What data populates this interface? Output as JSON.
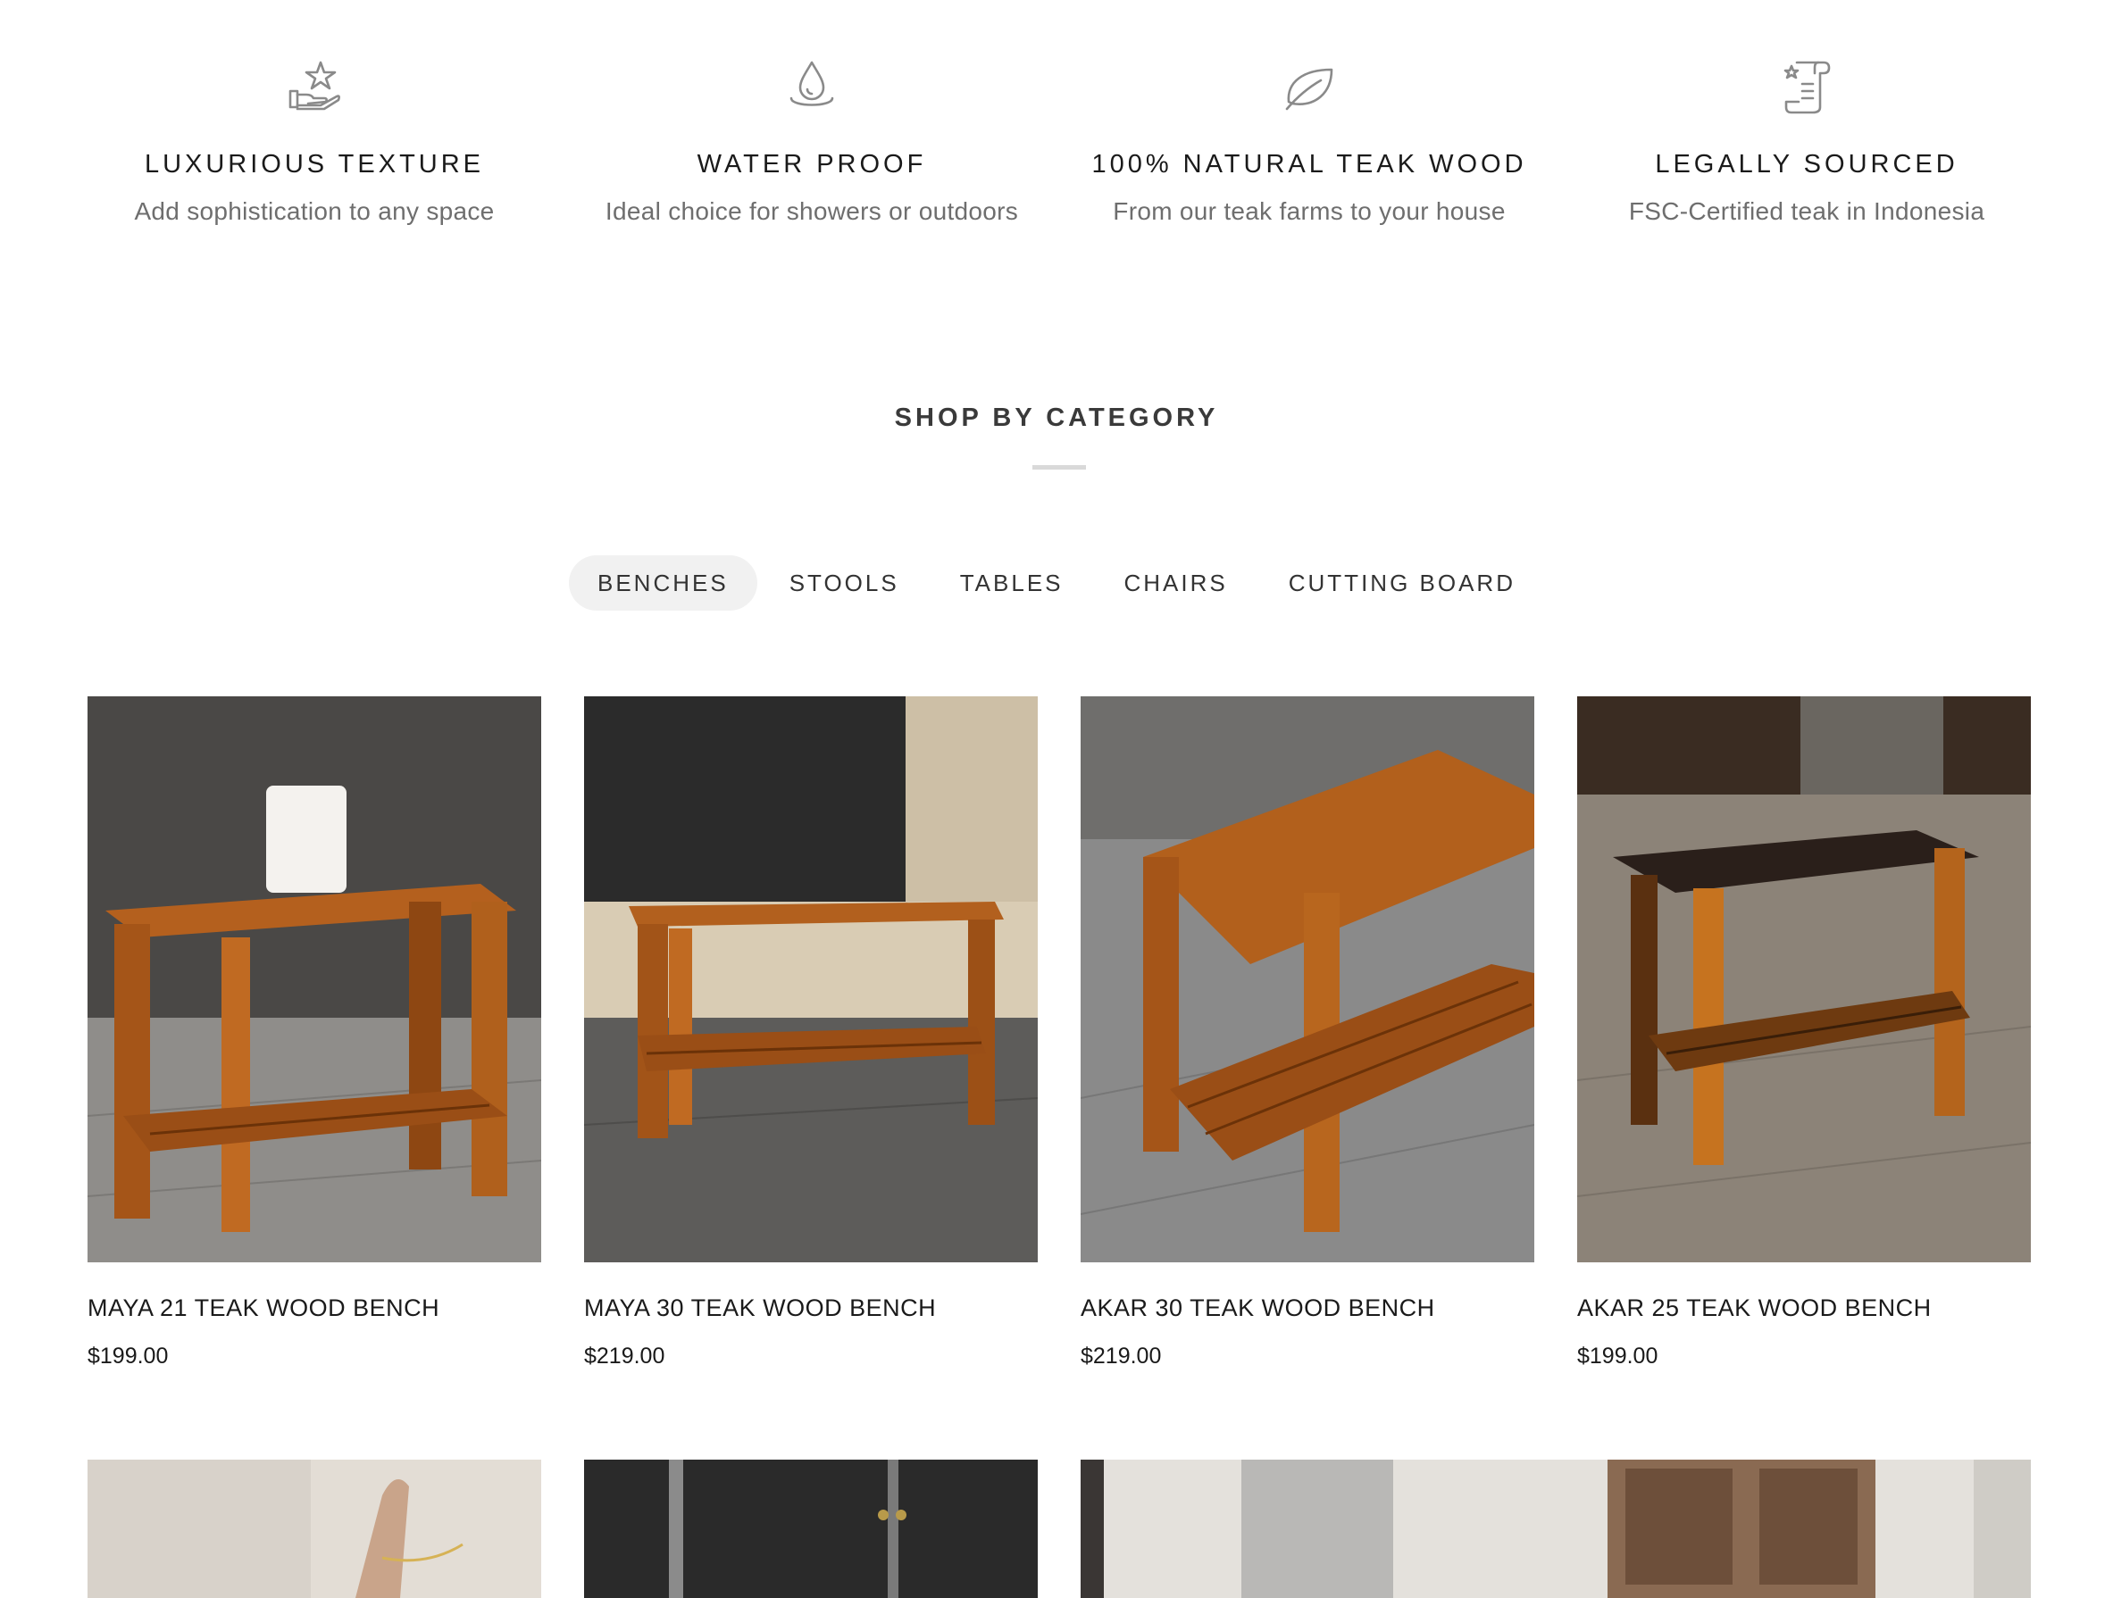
{
  "features": [
    {
      "icon": "star-in-hand-icon",
      "title": "LUXURIOUS TEXTURE",
      "description": "Add sophistication to any space"
    },
    {
      "icon": "water-drop-icon",
      "title": "WATER PROOF",
      "description": "Ideal choice for showers or outdoors"
    },
    {
      "icon": "leaf-icon",
      "title": "100% NATURAL TEAK WOOD",
      "description": "From our teak farms to your house"
    },
    {
      "icon": "certificate-scroll-icon",
      "title": "LEGALLY SOURCED",
      "description": "FSC-Certified teak in Indonesia"
    }
  ],
  "section": {
    "title": "SHOP BY CATEGORY"
  },
  "tabs": [
    {
      "label": "BENCHES",
      "active": true
    },
    {
      "label": "STOOLS",
      "active": false
    },
    {
      "label": "TABLES",
      "active": false
    },
    {
      "label": "CHAIRS",
      "active": false
    },
    {
      "label": "CUTTING BOARD",
      "active": false
    }
  ],
  "products": [
    {
      "name": "MAYA 21 TEAK WOOD BENCH",
      "price": "$199.00"
    },
    {
      "name": "MAYA 30 TEAK WOOD BENCH",
      "price": "$219.00"
    },
    {
      "name": "AKAR 30 TEAK WOOD BENCH",
      "price": "$219.00"
    },
    {
      "name": "AKAR 25 TEAK WOOD BENCH",
      "price": "$199.00"
    }
  ],
  "colors": {
    "teak": "#b5601c",
    "teak_dark": "#7a3a10",
    "muted_icon": "#8a8a8a",
    "tab_active_bg": "#f1f1f1"
  }
}
